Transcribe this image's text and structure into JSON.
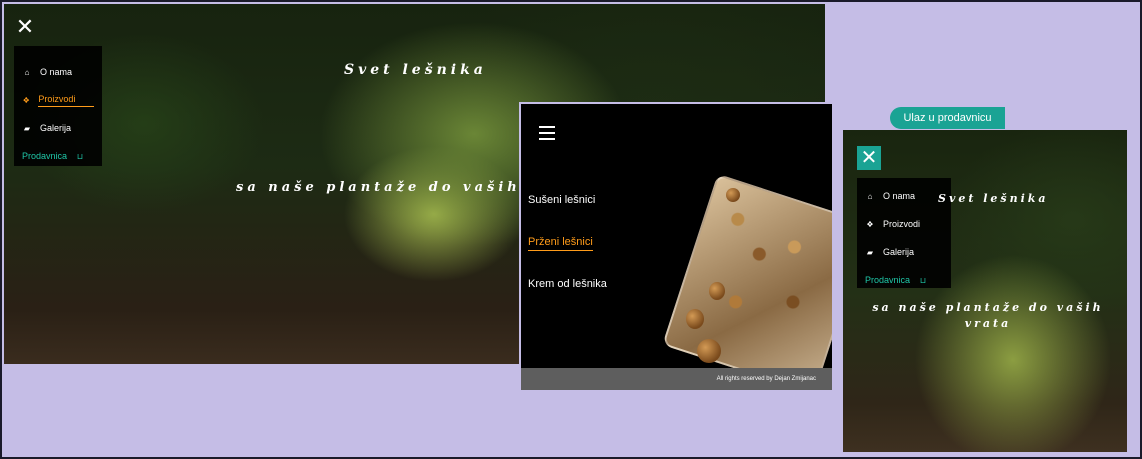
{
  "nav": {
    "items": [
      {
        "icon": "home-icon",
        "glyph": "⌂",
        "label": "O nama"
      },
      {
        "icon": "gift-icon",
        "glyph": "❖",
        "label": "Proizvodi"
      },
      {
        "icon": "book-icon",
        "glyph": "▰",
        "label": "Galerija"
      },
      {
        "icon": "basket-icon",
        "glyph": "⊔",
        "label": "Prodavnica"
      }
    ]
  },
  "hero": {
    "title": "Svet lešnika",
    "subtitle": "sa naše plantaže do vaših",
    "mobile_subtitle": "sa naše plantaže do vaših vrata"
  },
  "products": {
    "items": [
      "Sušeni lešnici",
      "Prženi lešnici",
      "Krem od lešnika"
    ],
    "footer": "All rights reserved by Dejan Zmijanac"
  },
  "shop_button": "Ulaz u prodavnicu",
  "colors": {
    "accent": "#ff9c1a",
    "teal": "#1aa394",
    "shop_text": "#1fc7a8",
    "background": "#c5bde6"
  }
}
